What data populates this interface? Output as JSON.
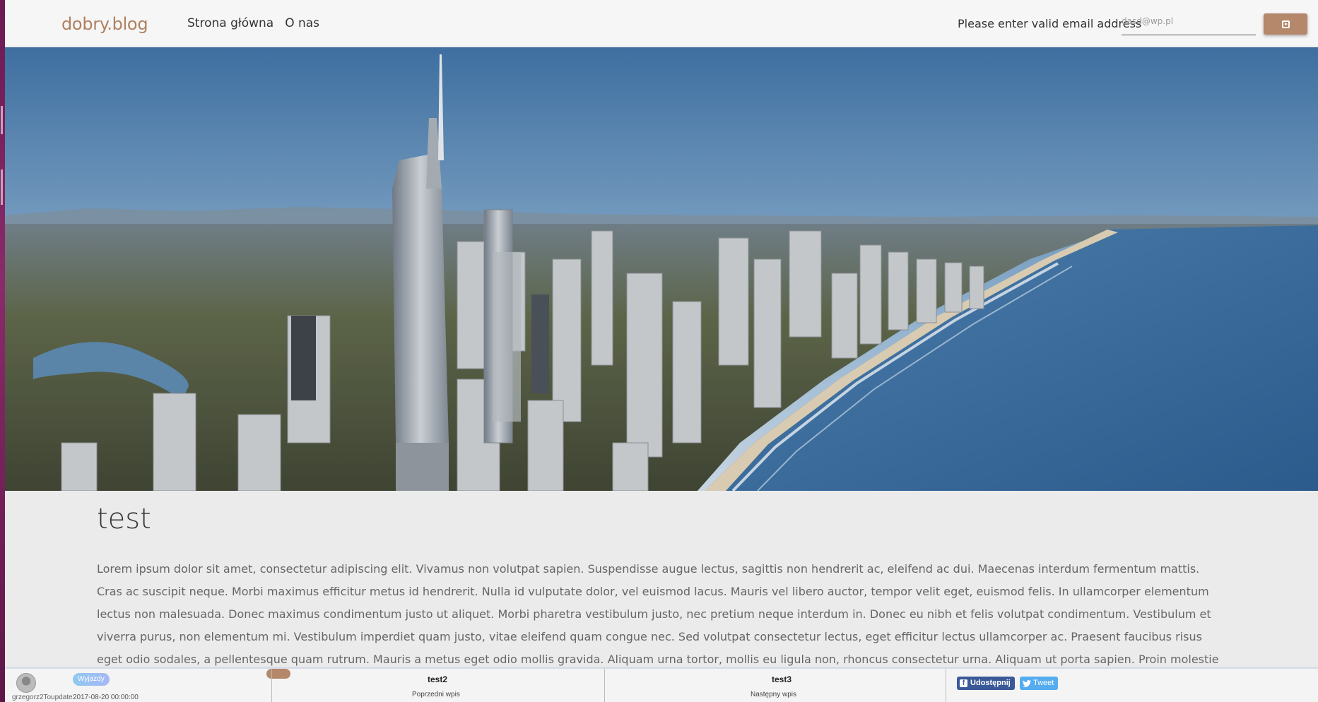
{
  "header": {
    "brand": "dobry.blog",
    "nav": [
      "Strona główna",
      "O nas"
    ],
    "subscribe_label": "Please enter valid email address",
    "email_value": "dasd@wp.pl"
  },
  "article": {
    "title": "test",
    "body": "Lorem ipsum dolor sit amet, consectetur adipiscing elit. Vivamus non volutpat sapien. Suspendisse augue lectus, sagittis non hendrerit ac, eleifend ac dui. Maecenas interdum fermentum mattis. Cras ac suscipit neque. Morbi maximus efficitur metus id hendrerit. Nulla id vulputate dolor, vel euismod lacus. Mauris vel libero auctor, tempor velit eget, euismod felis. In ullamcorper elementum lectus non malesuada. Donec maximus condimentum justo ut aliquet. Morbi pharetra vestibulum justo, nec pretium neque interdum in. Donec eu nibh et felis volutpat condimentum. Vestibulum et viverra purus, non elementum mi. Vestibulum imperdiet quam justo, vitae eleifend quam congue nec. Sed volutpat consectetur lectus, eget efficitur lectus ullamcorper ac. Praesent faucibus risus eget odio sodales, a pellentesque quam rutrum. Mauris a metus eget odio mollis gravida. Aliquam urna tortor, mollis eu ligula non, rhoncus consectetur urna. Aliquam ut porta sapien. Proin molestie molestie ante, ut faucibus enim venenatis quis. In fermentum aliquam velit. Nunc facilisis tellus id interdum efficitur. Nam feugiat tempor velit, in finibus ante"
  },
  "footer": {
    "author": "grzegorz2Toupdate",
    "tag": "Wyjazdy",
    "date": "2017-08-20 00:00:00",
    "prev_title": "test2",
    "prev_label": "Poprzedni wpis",
    "next_title": "test3",
    "next_label": "Następny wpis",
    "share_label": "Udostępnij",
    "tweet_label": "Tweet"
  },
  "colors": {
    "accent": "#b5876b",
    "brand": "#b08060",
    "facebook": "#3b5998",
    "twitter": "#55acee"
  }
}
